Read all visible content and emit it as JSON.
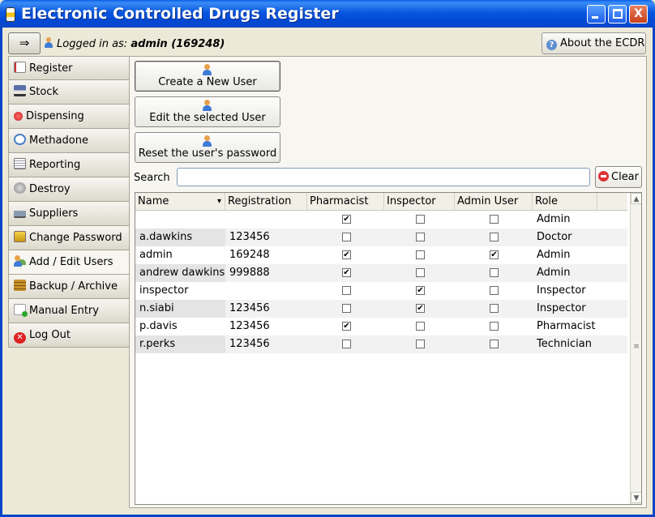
{
  "window": {
    "title": "Electronic Controlled Drugs Register",
    "buttons": {
      "minimize": "_",
      "maximize": "□",
      "close": "X"
    }
  },
  "header": {
    "login_prefix": "Logged in as:",
    "login_user": "admin (169248)",
    "about_label": "About the ECDR"
  },
  "sidebar": {
    "items": [
      {
        "label": "Register",
        "icon": "register-icon"
      },
      {
        "label": "Stock",
        "icon": "truck-icon"
      },
      {
        "label": "Dispensing",
        "icon": "pill-icon"
      },
      {
        "label": "Methadone",
        "icon": "dial-icon"
      },
      {
        "label": "Reporting",
        "icon": "report-icon"
      },
      {
        "label": "Destroy",
        "icon": "destroy-icon"
      },
      {
        "label": "Suppliers",
        "icon": "supplier-icon"
      },
      {
        "label": "Change Password",
        "icon": "password-icon"
      },
      {
        "label": "Add / Edit Users",
        "icon": "users-icon",
        "active": true
      },
      {
        "label": "Backup / Archive",
        "icon": "backup-icon"
      },
      {
        "label": "Manual Entry",
        "icon": "manual-entry-icon"
      },
      {
        "label": "Log Out",
        "icon": "logout-icon"
      }
    ]
  },
  "actions": {
    "create_user": "Create a New User",
    "edit_user": "Edit the selected User",
    "reset_password": "Reset the user's password"
  },
  "search": {
    "label": "Search",
    "value": "",
    "placeholder": "",
    "clear_label": "Clear"
  },
  "table": {
    "columns": [
      "Name",
      "Registration",
      "Pharmacist",
      "Inspector",
      "Admin User",
      "Role"
    ],
    "rows": [
      {
        "name": "",
        "registration": "",
        "pharmacist": true,
        "inspector": false,
        "admin": false,
        "role": "Admin"
      },
      {
        "name": "a.dawkins",
        "registration": "123456",
        "pharmacist": false,
        "inspector": false,
        "admin": false,
        "role": "Doctor"
      },
      {
        "name": "admin",
        "registration": "169248",
        "pharmacist": true,
        "inspector": false,
        "admin": true,
        "role": "Admin"
      },
      {
        "name": "andrew dawkins",
        "registration": "999888",
        "pharmacist": true,
        "inspector": false,
        "admin": false,
        "role": "Admin"
      },
      {
        "name": "inspector",
        "registration": "",
        "pharmacist": false,
        "inspector": true,
        "admin": false,
        "role": "Inspector"
      },
      {
        "name": "n.siabi",
        "registration": "123456",
        "pharmacist": false,
        "inspector": true,
        "admin": false,
        "role": "Inspector"
      },
      {
        "name": "p.davis",
        "registration": "123456",
        "pharmacist": true,
        "inspector": false,
        "admin": false,
        "role": "Pharmacist"
      },
      {
        "name": "r.perks",
        "registration": "123456",
        "pharmacist": false,
        "inspector": false,
        "admin": false,
        "role": "Technician"
      }
    ]
  },
  "icons": {
    "check_glyph": "✔",
    "chevron": "▾",
    "scroll_up": "▲",
    "scroll_down": "▼",
    "scroll_grip": "≡",
    "login_arrow": "⇒",
    "about": "?",
    "logout": "✕"
  }
}
